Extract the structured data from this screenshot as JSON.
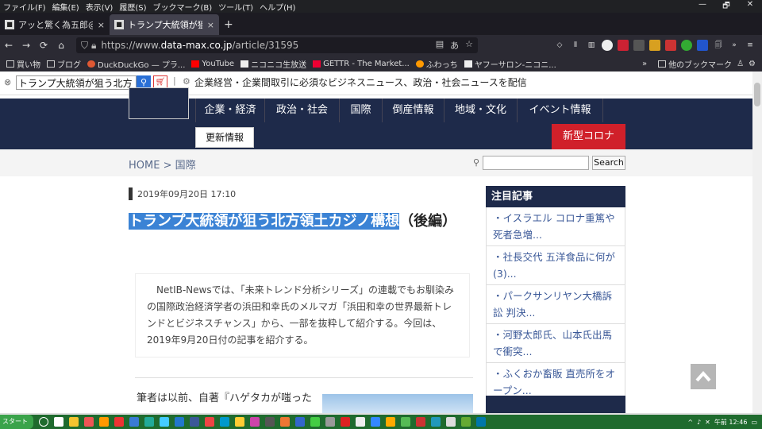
{
  "menubar": {
    "items": [
      "ファイル(F)",
      "編集(E)",
      "表示(V)",
      "履歴(S)",
      "ブックマーク(B)",
      "ツール(T)",
      "ヘルプ(H)"
    ],
    "window_controls": [
      "—",
      "🗗",
      "✕"
    ]
  },
  "tabs": [
    {
      "label": "アッと驚く為五郎@ゼ",
      "close": "×"
    },
    {
      "label": "トランプ大統領が狙う北",
      "close": "×"
    }
  ],
  "new_tab": "+",
  "nav": {
    "back": "←",
    "forward": "→",
    "reload": "⟳",
    "home": "⌂"
  },
  "url": {
    "prefix": "https://www.",
    "domain": "data-max.co.jp",
    "path": "/article/31595"
  },
  "bookmarks": [
    "買い物",
    "ブログ",
    "DuckDuckGo — プラ...",
    "YouTube",
    "ニコニコ生放送",
    "GETTR - The Market...",
    "ふわっち",
    "ヤフーサロン-ニコニ..."
  ],
  "bookmarks_more": "»",
  "other_bookmarks": "他のブックマーク",
  "page": {
    "search_value": "トランプ大統領が狙う北方",
    "tagline": "企業経営・企業間取引に必須なビジネスニュース、政治・社会ニュースを配信",
    "nav_items": [
      "企業・経済",
      "政治・社会",
      "国際",
      "倒産情報",
      "地域・文化",
      "イベント情報"
    ],
    "update_btn": "更新情報",
    "covid_btn": "新型コロナ",
    "breadcrumb": "HOME > 国際",
    "search_button": "Search",
    "date": "2019年09月20日 17:10",
    "title_highlight": "トランプ大統領が狙う北方領土カジノ構想",
    "title_rest": "（後編）",
    "intro": "NetIB-Newsでは、「未来トレンド分析シリーズ」の連載でもお馴染みの国際政治経済学者の浜田和幸氏のメルマガ「浜田和幸の世界最新トレンドとビジネスチャンス」から、一部を抜粋して紹介する。今回は、2019年9月20日付の記事を紹介する。",
    "body_start": "筆者は以前、自著『ハゲタカが嗤った",
    "sidebar_title": "注目記事",
    "sidebar_items": [
      "・イスラエル コロナ重篤や死者急増...",
      "・社長交代 五洋食品に何が(3)...",
      "・パークサンリヤン大橋訴訟 判決...",
      "・河野太郎氏、山本氏出馬で衝突...",
      "・ふくおか畜販 直売所をオープン..."
    ]
  },
  "taskbar": {
    "start": "スタート",
    "clock": "午前 12:46"
  }
}
